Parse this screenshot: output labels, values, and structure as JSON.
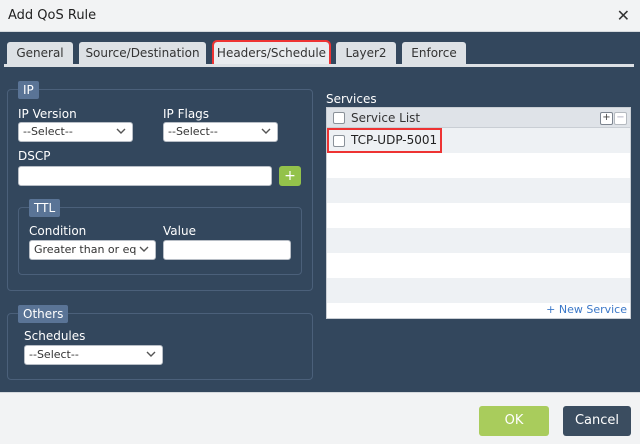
{
  "dialog": {
    "title": "Add QoS Rule",
    "close_icon": "close-icon"
  },
  "tabs": [
    {
      "label": "General",
      "active": false
    },
    {
      "label": "Source/Destination",
      "active": false
    },
    {
      "label": "Headers/Schedule",
      "active": true
    },
    {
      "label": "Layer2",
      "active": false
    },
    {
      "label": "Enforce",
      "active": false
    }
  ],
  "ip": {
    "legend": "IP",
    "version_label": "IP Version",
    "version_value": "--Select--",
    "flags_label": "IP Flags",
    "flags_value": "--Select--",
    "dscp_label": "DSCP",
    "dscp_value": "",
    "dscp_add": "+",
    "ttl": {
      "legend": "TTL",
      "condition_label": "Condition",
      "condition_value": "Greater than or eq",
      "value_label": "Value",
      "value_value": ""
    }
  },
  "others": {
    "legend": "Others",
    "schedules_label": "Schedules",
    "schedules_value": "--Select--"
  },
  "services": {
    "title": "Services",
    "header": "Service List",
    "add_icon": "+",
    "remove_icon": "−",
    "items": [
      "TCP-UDP-5001"
    ],
    "new_link": "+ New Service"
  },
  "footer": {
    "ok": "OK",
    "cancel": "Cancel"
  },
  "colors": {
    "background": "#33475d",
    "ok": "#a9cc5c",
    "cancel": "#3b4d60",
    "highlight": "#e33333"
  }
}
